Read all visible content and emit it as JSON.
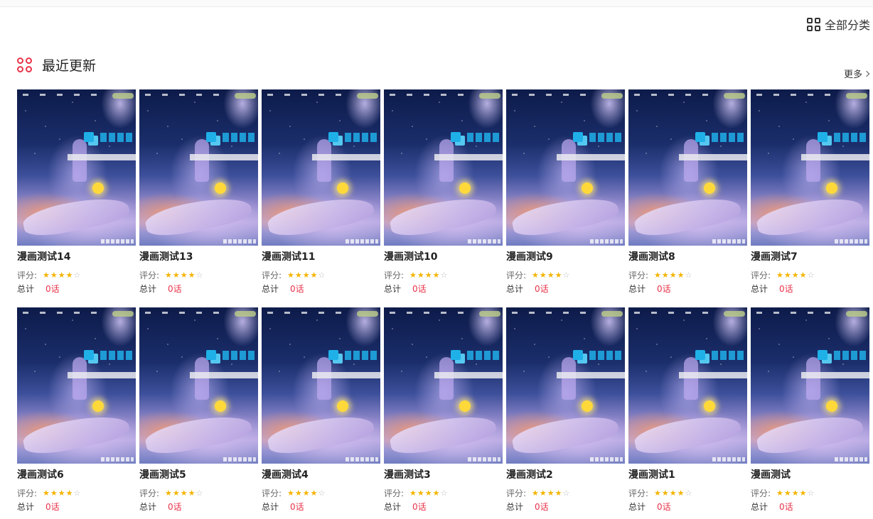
{
  "header": {
    "all_categories": "全部分类"
  },
  "section": {
    "title": "最近更新",
    "more": "更多"
  },
  "colors": {
    "accent": "#e8334a",
    "star": "#f4b400"
  },
  "card_labels": {
    "rating_label": "评分:",
    "total_label": "总计"
  },
  "comics": [
    {
      "name": "漫画测试14",
      "rating": 4,
      "max_rating": 5,
      "episodes": "0话"
    },
    {
      "name": "漫画测试13",
      "rating": 4,
      "max_rating": 5,
      "episodes": "0话"
    },
    {
      "name": "漫画测试11",
      "rating": 4,
      "max_rating": 5,
      "episodes": "0话"
    },
    {
      "name": "漫画测试10",
      "rating": 4,
      "max_rating": 5,
      "episodes": "0话"
    },
    {
      "name": "漫画测试9",
      "rating": 4,
      "max_rating": 5,
      "episodes": "0话"
    },
    {
      "name": "漫画测试8",
      "rating": 4,
      "max_rating": 5,
      "episodes": "0话"
    },
    {
      "name": "漫画测试7",
      "rating": 4,
      "max_rating": 5,
      "episodes": "0话"
    },
    {
      "name": "漫画测试6",
      "rating": 4,
      "max_rating": 5,
      "episodes": "0话"
    },
    {
      "name": "漫画测试5",
      "rating": 4,
      "max_rating": 5,
      "episodes": "0话"
    },
    {
      "name": "漫画测试4",
      "rating": 4,
      "max_rating": 5,
      "episodes": "0话"
    },
    {
      "name": "漫画测试3",
      "rating": 4,
      "max_rating": 5,
      "episodes": "0话"
    },
    {
      "name": "漫画测试2",
      "rating": 4,
      "max_rating": 5,
      "episodes": "0话"
    },
    {
      "name": "漫画测试1",
      "rating": 4,
      "max_rating": 5,
      "episodes": "0话"
    },
    {
      "name": "漫画测试",
      "rating": 4,
      "max_rating": 5,
      "episodes": "0话"
    }
  ]
}
